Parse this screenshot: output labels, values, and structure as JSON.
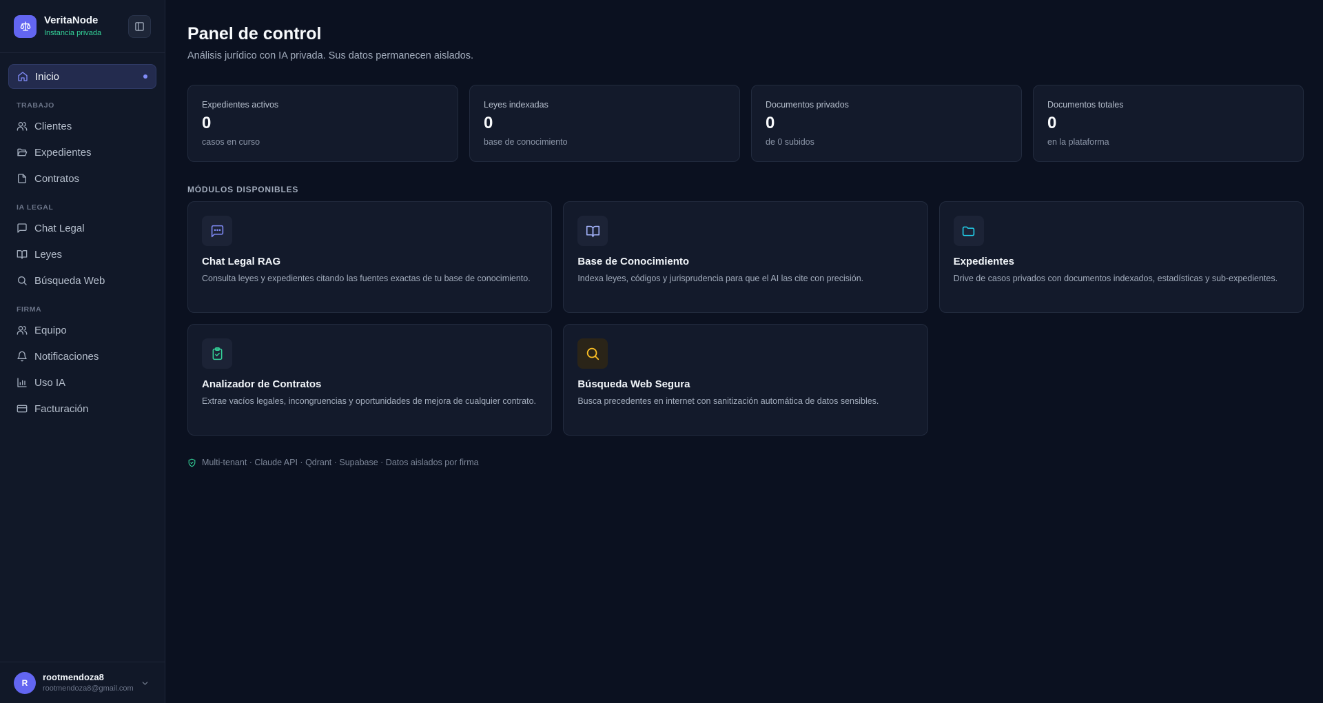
{
  "brand": {
    "name": "VeritaNode",
    "subtitle": "Instancia privada"
  },
  "sidebar": {
    "home": {
      "label": "Inicio",
      "icon": "home-icon"
    },
    "sections": [
      {
        "title": "TRABAJO",
        "items": [
          {
            "label": "Clientes",
            "icon": "users-icon"
          },
          {
            "label": "Expedientes",
            "icon": "folder-open-icon"
          },
          {
            "label": "Contratos",
            "icon": "file-icon"
          }
        ]
      },
      {
        "title": "IA LEGAL",
        "items": [
          {
            "label": "Chat Legal",
            "icon": "chat-icon"
          },
          {
            "label": "Leyes",
            "icon": "book-icon"
          },
          {
            "label": "Búsqueda Web",
            "icon": "search-icon"
          }
        ]
      },
      {
        "title": "FIRMA",
        "items": [
          {
            "label": "Equipo",
            "icon": "team-icon"
          },
          {
            "label": "Notificaciones",
            "icon": "bell-icon"
          },
          {
            "label": "Uso IA",
            "icon": "bar-chart-icon"
          },
          {
            "label": "Facturación",
            "icon": "credit-card-icon"
          }
        ]
      }
    ]
  },
  "user": {
    "initial": "R",
    "name": "rootmendoza8",
    "email": "rootmendoza8@gmail.com"
  },
  "main": {
    "title": "Panel de control",
    "subtitle": "Análisis jurídico con IA privada. Sus datos permanecen aislados.",
    "stats": [
      {
        "label": "Expedientes activos",
        "value": "0",
        "desc": "casos en curso"
      },
      {
        "label": "Leyes indexadas",
        "value": "0",
        "desc": "base de conocimiento"
      },
      {
        "label": "Documentos privados",
        "value": "0",
        "desc": "de 0 subidos"
      },
      {
        "label": "Documentos totales",
        "value": "0",
        "desc": "en la plataforma"
      }
    ],
    "modules_title": "MÓDULOS DISPONIBLES",
    "modules": [
      {
        "title": "Chat Legal RAG",
        "desc": "Consulta leyes y expedientes citando las fuentes exactas de tu base de conocimiento.",
        "icon": "chat-icon",
        "color": "#818cf8"
      },
      {
        "title": "Base de Conocimiento",
        "desc": "Indexa leyes, códigos y jurisprudencia para que el AI las cite con precisión.",
        "icon": "book-icon",
        "color": "#a5b4fc"
      },
      {
        "title": "Expedientes",
        "desc": "Drive de casos privados con documentos indexados, estadísticas y sub-expedientes.",
        "icon": "folder-icon",
        "color": "#22d3ee"
      },
      {
        "title": "Analizador de Contratos",
        "desc": "Extrae vacíos legales, incongruencias y oportunidades de mejora de cualquier contrato.",
        "icon": "clipboard-check-icon",
        "color": "#34d399"
      },
      {
        "title": "Búsqueda Web Segura",
        "desc": "Busca precedentes en internet con sanitización automática de datos sensibles.",
        "icon": "search-icon",
        "color": "#fbbf24"
      }
    ],
    "footer": "Multi-tenant · Claude API · Qdrant · Supabase · Datos aislados por firma"
  }
}
